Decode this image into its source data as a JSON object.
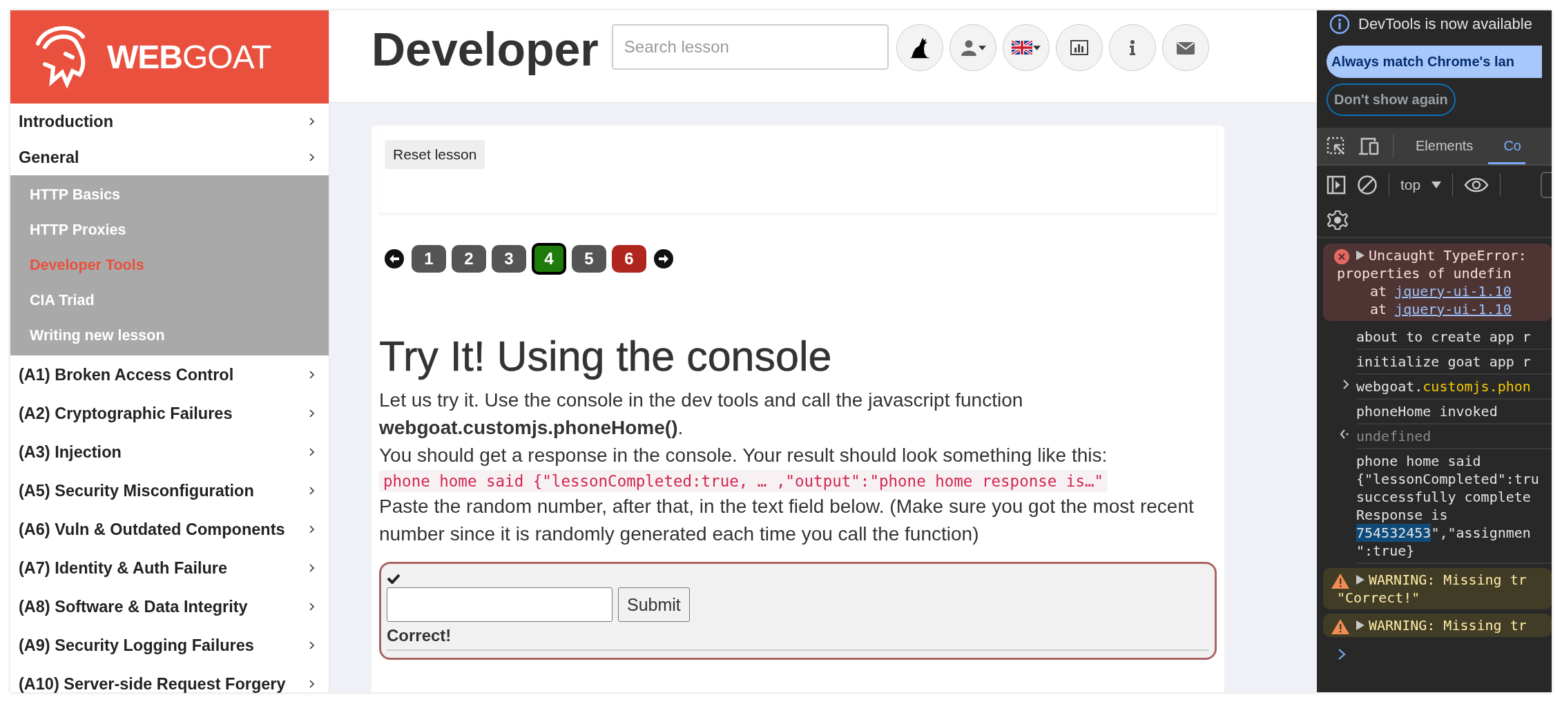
{
  "sidebar": {
    "logo": "**WEB**GOAT",
    "items": [
      {
        "label": "Introduction"
      },
      {
        "label": "General",
        "children": [
          {
            "label": "HTTP Basics",
            "selected": false
          },
          {
            "label": "HTTP Proxies",
            "selected": false
          },
          {
            "label": "Developer Tools",
            "selected": true
          },
          {
            "label": "CIA Triad",
            "selected": false
          },
          {
            "label": "Writing new lesson",
            "selected": false
          }
        ]
      },
      {
        "label": "(A1) Broken Access Control"
      },
      {
        "label": "(A2) Cryptographic Failures"
      },
      {
        "label": "(A3) Injection"
      },
      {
        "label": "(A5) Security Misconfiguration"
      },
      {
        "label": "(A6) Vuln & Outdated Components"
      },
      {
        "label": "(A7) Identity & Auth Failure"
      },
      {
        "label": "(A8) Software & Data Integrity"
      },
      {
        "label": "(A9) Security Logging Failures"
      },
      {
        "label": "(A10) Server-side Request Forgery"
      }
    ]
  },
  "header": {
    "title": "Developer",
    "search": {
      "placeholder": "Search lesson"
    },
    "buttons": [
      {
        "kind": "wolf",
        "dropdown": false
      },
      {
        "kind": "user",
        "dropdown": true
      },
      {
        "kind": "language",
        "dropdown": true
      },
      {
        "kind": "chart",
        "dropdown": false
      },
      {
        "kind": "info",
        "dropdown": false
      },
      {
        "kind": "mail",
        "dropdown": false
      }
    ]
  },
  "lesson": {
    "reset_button": "Reset lesson",
    "pages": [
      {
        "label": "1",
        "kind": "plain",
        "selected": false
      },
      {
        "label": "2",
        "kind": "plain",
        "selected": false
      },
      {
        "label": "3",
        "kind": "plain",
        "selected": false
      },
      {
        "label": "4",
        "kind": "solved",
        "selected": true
      },
      {
        "label": "5",
        "kind": "plain",
        "selected": false
      },
      {
        "label": "6",
        "kind": "unsolved",
        "selected": false
      }
    ],
    "heading": "Try It! Using the console",
    "body": [
      {
        "kind": "text",
        "text": "Let us try it. Use the console in the dev tools and call the javascript function **webgoat.customjs.phoneHome()**."
      },
      {
        "kind": "text",
        "text": "You should get a response in the console. Your result should look something like this:"
      },
      {
        "kind": "code",
        "text": "phone home said {\"lessonCompleted:true, … ,\"output\":\"phone home response is…\""
      },
      {
        "kind": "text",
        "text": "Paste the random number, after that, in the text field below. (Make sure you got the most recent number since it is randomly generated each time you call the function)"
      }
    ],
    "form": {
      "solved": true,
      "submit_button": "Submit",
      "feedback": "Correct!"
    }
  },
  "devtools": {
    "notice": "DevTools is now available",
    "primary_button": "Always match Chrome's lan",
    "secondary_button": "Don't show again",
    "tabs": [
      {
        "label": "Elements",
        "selected": false
      },
      {
        "label": "Co",
        "selected": true
      }
    ],
    "context": "top",
    "console": [
      {
        "kind": "error",
        "lines": [
          [
            {
              "text": "Uncaught TypeError:"
            }
          ],
          [
            {
              "text": "properties of undefin"
            }
          ],
          [
            {
              "text": "at ",
              "kind": "trace"
            },
            {
              "text": "jquery-ui-1.10",
              "kind": "link"
            }
          ],
          [
            {
              "text": "at ",
              "kind": "trace"
            },
            {
              "text": "jquery-ui-1.10",
              "kind": "link"
            }
          ]
        ]
      },
      {
        "kind": "log",
        "lines": [
          [
            {
              "text": "about to create app r"
            }
          ]
        ]
      },
      {
        "kind": "log",
        "lines": [
          [
            {
              "text": "initialize goat app r"
            }
          ]
        ]
      },
      {
        "kind": "input",
        "lines": [
          [
            {
              "text": "webgoat."
            },
            {
              "text": "customjs.phon",
              "kind": "property"
            }
          ]
        ]
      },
      {
        "kind": "log",
        "lines": [
          [
            {
              "text": "phoneHome invoked"
            }
          ]
        ]
      },
      {
        "kind": "result",
        "lines": [
          [
            {
              "text": "undefined"
            }
          ]
        ]
      },
      {
        "kind": "log",
        "lines": [
          [
            {
              "text": "phone home said"
            }
          ],
          [
            {
              "text": "{\"lessonCompleted\":tru"
            }
          ],
          [
            {
              "text": "successfully complete"
            }
          ],
          [
            {
              "text": "Response is"
            }
          ],
          [
            {
              "text": "754532453",
              "kind": "selected"
            },
            {
              "text": "\",\"assignmen"
            }
          ],
          [
            {
              "text": "\":true}"
            }
          ]
        ]
      },
      {
        "kind": "warning",
        "lines": [
          [
            {
              "text": "WARNING: Missing tr"
            }
          ],
          [
            {
              "text": "\"Correct!\""
            }
          ]
        ]
      },
      {
        "kind": "warning",
        "lines": [
          [
            {
              "text": "WARNING: Missing tr"
            }
          ]
        ]
      }
    ]
  }
}
